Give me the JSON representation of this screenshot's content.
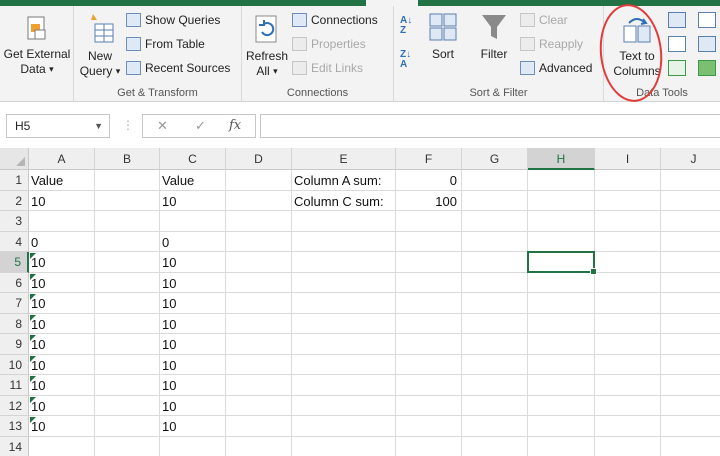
{
  "ribbon": {
    "groups": {
      "get_transform": "Get & Transform",
      "connections": "Connections",
      "sort_filter": "Sort & Filter",
      "data_tools": "Data Tools"
    },
    "get_external_data": {
      "line1": "Get External",
      "line2": "Data"
    },
    "new_query": {
      "line1": "New",
      "line2": "Query"
    },
    "show_queries": "Show Queries",
    "from_table": "From Table",
    "recent_sources": "Recent Sources",
    "refresh_all": {
      "line1": "Refresh",
      "line2": "All"
    },
    "connections": "Connections",
    "properties": "Properties",
    "edit_links": "Edit Links",
    "sort": "Sort",
    "filter": "Filter",
    "clear": "Clear",
    "reapply": "Reapply",
    "advanced": "Advanced",
    "text_to_columns": {
      "line1": "Text to",
      "line2": "Columns"
    },
    "colors": {
      "accent": "#217346",
      "annotation_circle": "#e23a3a"
    }
  },
  "formula_bar": {
    "name_box": "H5",
    "cancel_glyph": "✕",
    "enter_glyph": "✓",
    "fx_glyph": "fx",
    "formula": ""
  },
  "sheet": {
    "columns": [
      "A",
      "B",
      "C",
      "D",
      "E",
      "F",
      "G",
      "H",
      "I",
      "J"
    ],
    "rows": [
      "1",
      "2",
      "3",
      "4",
      "5",
      "6",
      "7",
      "8",
      "9",
      "10",
      "11",
      "12",
      "13",
      "14"
    ],
    "selected_cell": "H5",
    "cells": {
      "A1": "Value",
      "C1": "Value",
      "E1": "Column A sum:",
      "F1": "0",
      "A2": "10",
      "C2": "10",
      "E2": "Column C sum:",
      "F2": "100",
      "A4": "0",
      "C4": "0",
      "A5": "10",
      "C5": "10",
      "A6": "10",
      "C6": "10",
      "A7": "10",
      "C7": "10",
      "A8": "10",
      "C8": "10",
      "A9": "10",
      "C9": "10",
      "A10": "10",
      "C10": "10",
      "A11": "10",
      "C11": "10",
      "A12": "10",
      "C12": "10",
      "A13": "10",
      "C13": "10"
    },
    "text_stored_number_rows": [
      "5",
      "6",
      "7",
      "8",
      "9",
      "10",
      "11",
      "12",
      "13"
    ]
  }
}
